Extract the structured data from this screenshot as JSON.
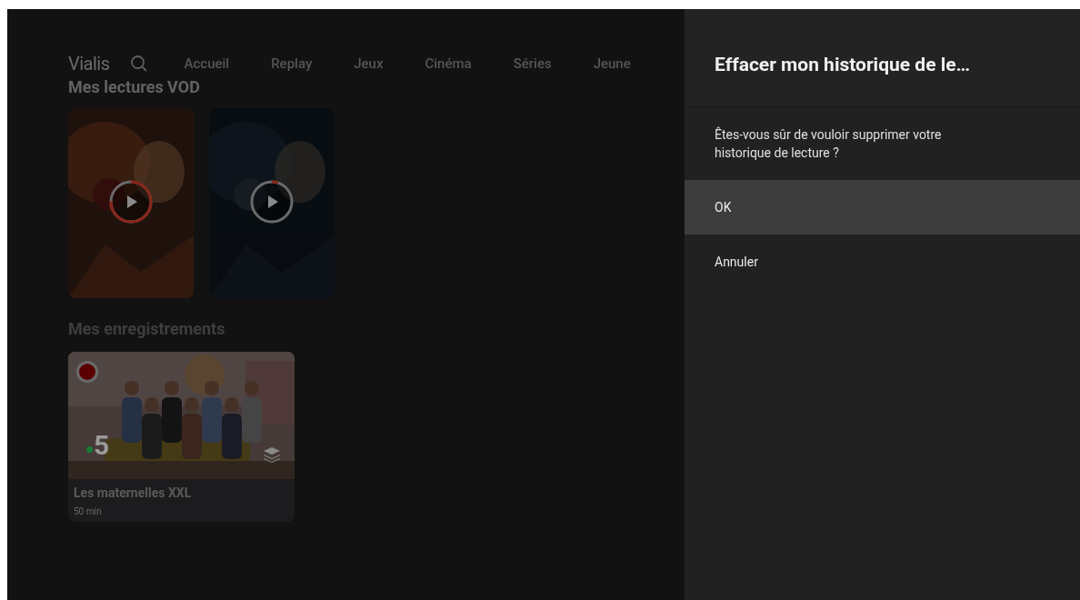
{
  "header": {
    "logo": "Vialis",
    "nav": [
      {
        "label": "Accueil"
      },
      {
        "label": "Replay"
      },
      {
        "label": "Jeux"
      },
      {
        "label": "Cinéma"
      },
      {
        "label": "Séries"
      },
      {
        "label": "Jeune"
      }
    ]
  },
  "vod_section": {
    "title": "Mes lectures VOD",
    "items": [
      {
        "level": 0.75
      },
      {
        "level": 0.05
      }
    ]
  },
  "recordings_section": {
    "title": "Mes enregistrements",
    "items": [
      {
        "channel_logo": "5",
        "title": "Les maternelles XXL",
        "duration": "50 min"
      }
    ]
  },
  "dialog": {
    "title": "Effacer mon historique de le…",
    "message": "Êtes-vous sûr de vouloir supprimer votre historique de lecture ?",
    "options": [
      {
        "label": "OK",
        "selected": true
      },
      {
        "label": "Annuler",
        "selected": false
      }
    ]
  }
}
